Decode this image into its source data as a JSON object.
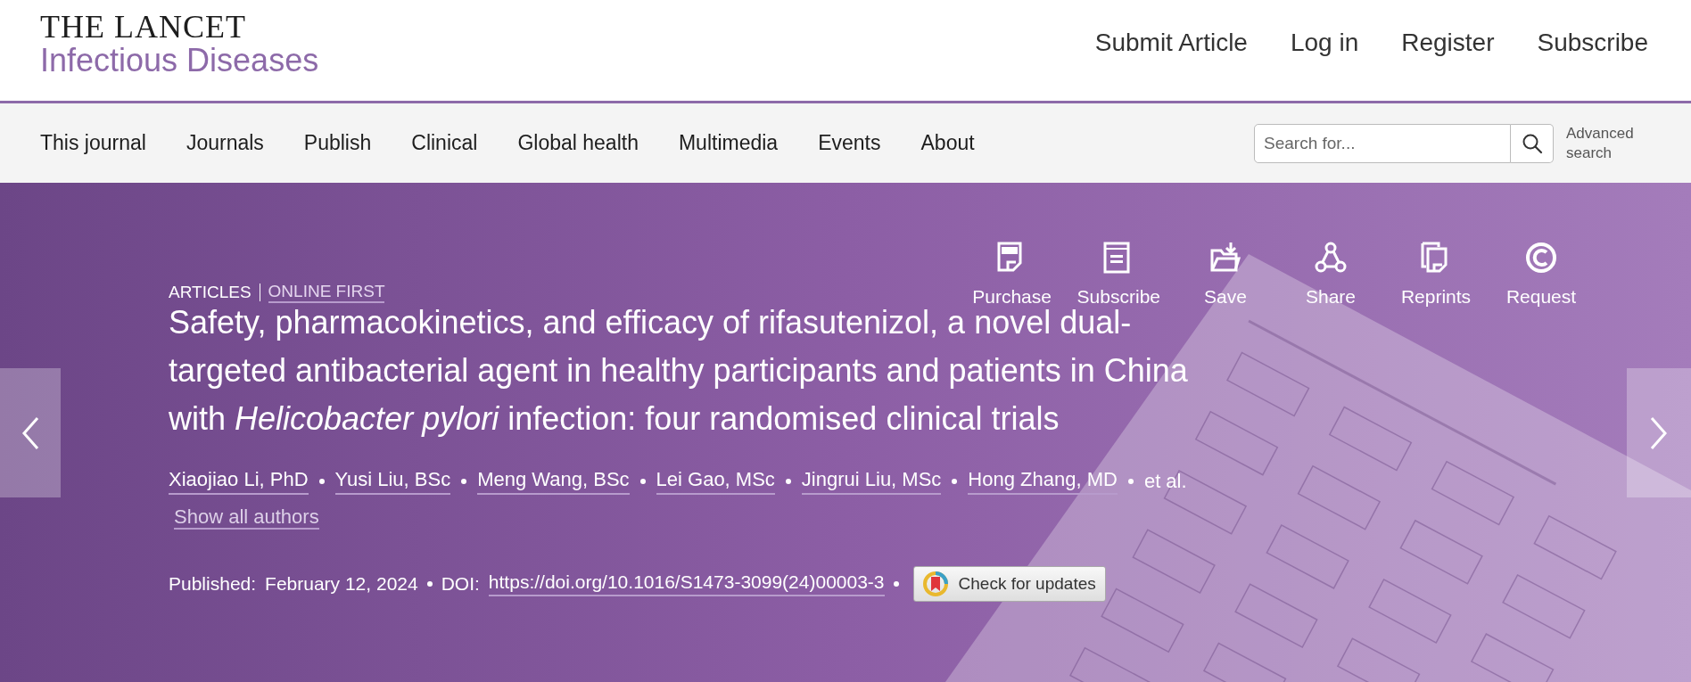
{
  "header": {
    "logo_title": "THE LANCET",
    "logo_subtitle": "Infectious Diseases",
    "links": [
      "Submit Article",
      "Log in",
      "Register",
      "Subscribe"
    ]
  },
  "nav": {
    "items": [
      "This journal",
      "Journals",
      "Publish",
      "Clinical",
      "Global health",
      "Multimedia",
      "Events",
      "About"
    ],
    "search": {
      "placeholder": "Search for..."
    },
    "advanced_search": "Advanced search"
  },
  "article": {
    "category": "ARTICLES",
    "status": "ONLINE FIRST",
    "actions": [
      "Purchase",
      "Subscribe",
      "Save",
      "Share",
      "Reprints",
      "Request"
    ],
    "title": "Safety, pharmacokinetics, and efficacy of rifasutenizol, a novel dual-targeted antibacterial agent in healthy participants and patients in China with *Helicobacter pylori* infection: four randomised clinical trials",
    "authors": [
      "Xiaojiao Li, PhD",
      "Yusi Liu, BSc",
      "Meng Wang, BSc",
      "Lei Gao, MSc",
      "Jingrui Liu, MSc",
      "Hong Zhang, MD"
    ],
    "et_al": "et al.",
    "show_all": "Show all authors",
    "published_label": "Published:",
    "published_date": "February 12, 2024",
    "doi_label": "DOI:",
    "doi": "https://doi.org/10.1016/S1473-3099(24)00003-3",
    "check_updates": "Check for updates"
  }
}
